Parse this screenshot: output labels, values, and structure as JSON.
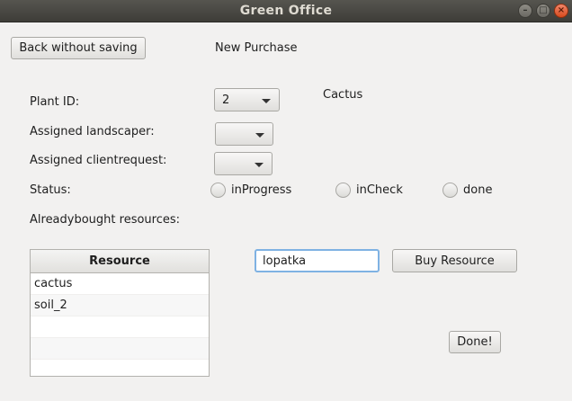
{
  "window": {
    "title": "Green Office"
  },
  "header": {
    "back_label": "Back without saving",
    "page_title": "New Purchase"
  },
  "form": {
    "plant_id_label": "Plant ID:",
    "plant_id_value": "2",
    "plant_name": "Cactus",
    "landscaper_label": "Assigned landscaper:",
    "landscaper_value": "",
    "clientrequest_label": "Assigned clientrequest:",
    "clientrequest_value": "",
    "status_label": "Status:",
    "status_options": [
      "inProgress",
      "inCheck",
      "done"
    ],
    "resources_label": "Alreadybought resources:"
  },
  "resources_table": {
    "header": "Resource",
    "rows": [
      "cactus",
      "soil_2",
      "",
      "",
      ""
    ]
  },
  "buy": {
    "input_value": "lopatka",
    "button_label": "Buy Resource"
  },
  "done_label": "Done!"
}
